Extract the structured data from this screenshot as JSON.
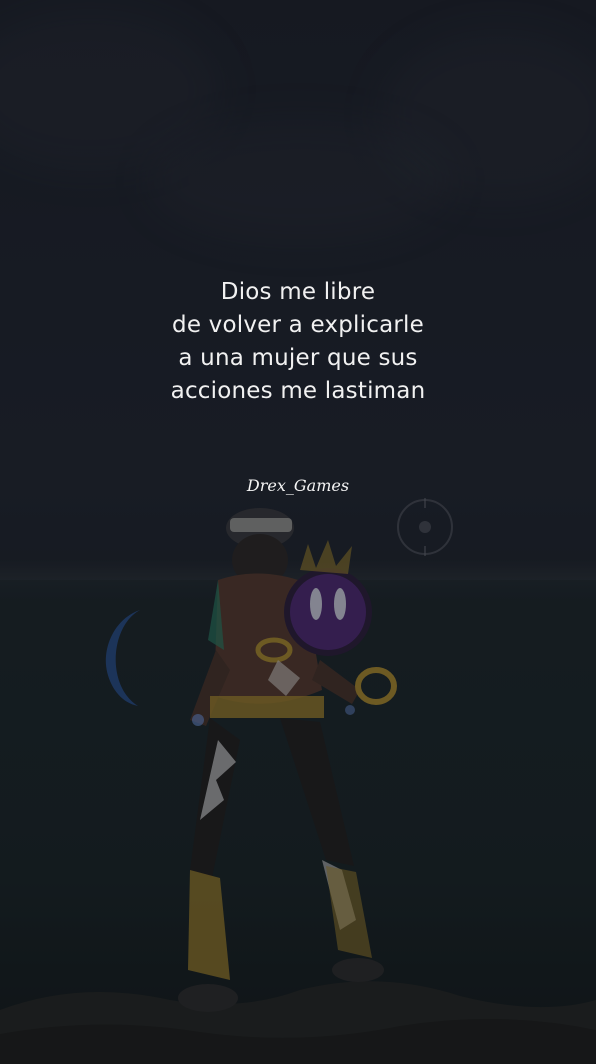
{
  "quote": {
    "lines": [
      "Dios me libre",
      "de volver a explicarle",
      "a una mujer que sus",
      "acciones me lastiman"
    ]
  },
  "watermark": {
    "text": "Drex_Games"
  },
  "colors": {
    "background": "#1c212b",
    "text": "#f1f1f1",
    "accent_purple": "#6a2fa0",
    "accent_gold": "#b8942a",
    "accent_blue": "#2b5fb0"
  }
}
